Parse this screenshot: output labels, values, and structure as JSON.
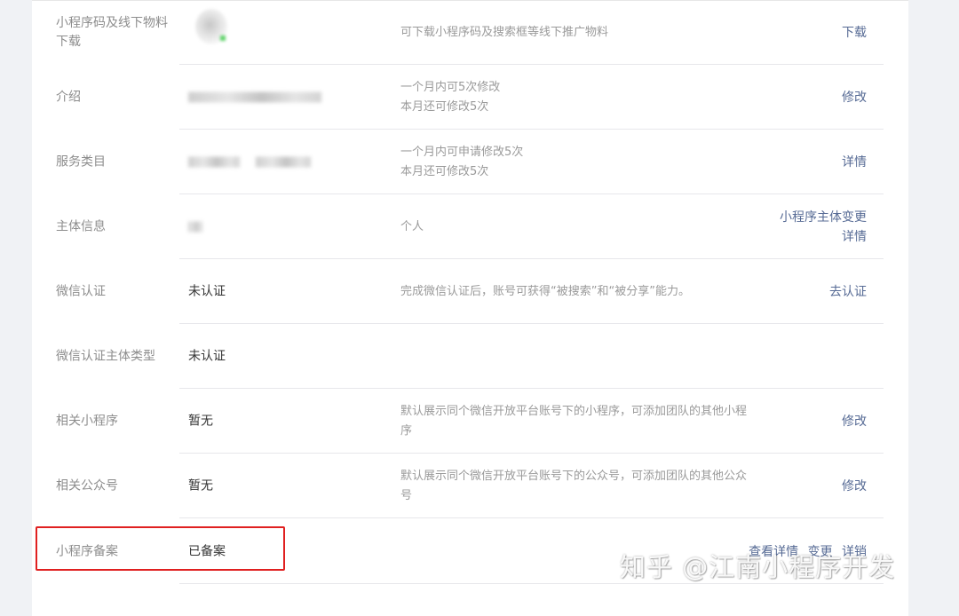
{
  "rows": [
    {
      "label": "小程序码及线下物料下载",
      "value": "",
      "desc_lines": [
        "可下载小程序码及搜索框等线下推广物料"
      ],
      "actions": [
        "下载"
      ]
    },
    {
      "label": "介绍",
      "value": "",
      "desc_lines": [
        "一个月内可5次修改",
        "本月还可修改5次"
      ],
      "actions": [
        "修改"
      ]
    },
    {
      "label": "服务类目",
      "value": "",
      "desc_lines": [
        "一个月内可申请修改5次",
        "本月还可修改5次"
      ],
      "actions": [
        "详情"
      ]
    },
    {
      "label": "主体信息",
      "value": "",
      "desc_lines": [
        "个人"
      ],
      "actions": [
        "小程序主体变更",
        "详情"
      ]
    },
    {
      "label": "微信认证",
      "value": "未认证",
      "desc_lines": [
        "完成微信认证后，账号可获得“被搜索”和“被分享”能力。"
      ],
      "actions": [
        "去认证"
      ]
    },
    {
      "label": "微信认证主体类型",
      "value": "未认证",
      "desc_lines": [],
      "actions": []
    },
    {
      "label": "相关小程序",
      "value": "暂无",
      "desc_lines": [
        "默认展示同个微信开放平台账号下的小程序，可添加团队的其他小程",
        "序"
      ],
      "actions": [
        "修改"
      ]
    },
    {
      "label": "相关公众号",
      "value": "暂无",
      "desc_lines": [
        "默认展示同个微信开放平台账号下的公众号，可添加团队的其他公众",
        "号"
      ],
      "actions": [
        "修改"
      ]
    },
    {
      "label": "小程序备案",
      "value": "已备案",
      "desc_lines": [],
      "actions": [
        "查看详情",
        "变更",
        "详销"
      ]
    }
  ],
  "watermark": "知乎 @江南小程序开发",
  "colors": {
    "link": "#576b95",
    "label": "#8d8d8d",
    "highlight": "#e02020"
  }
}
